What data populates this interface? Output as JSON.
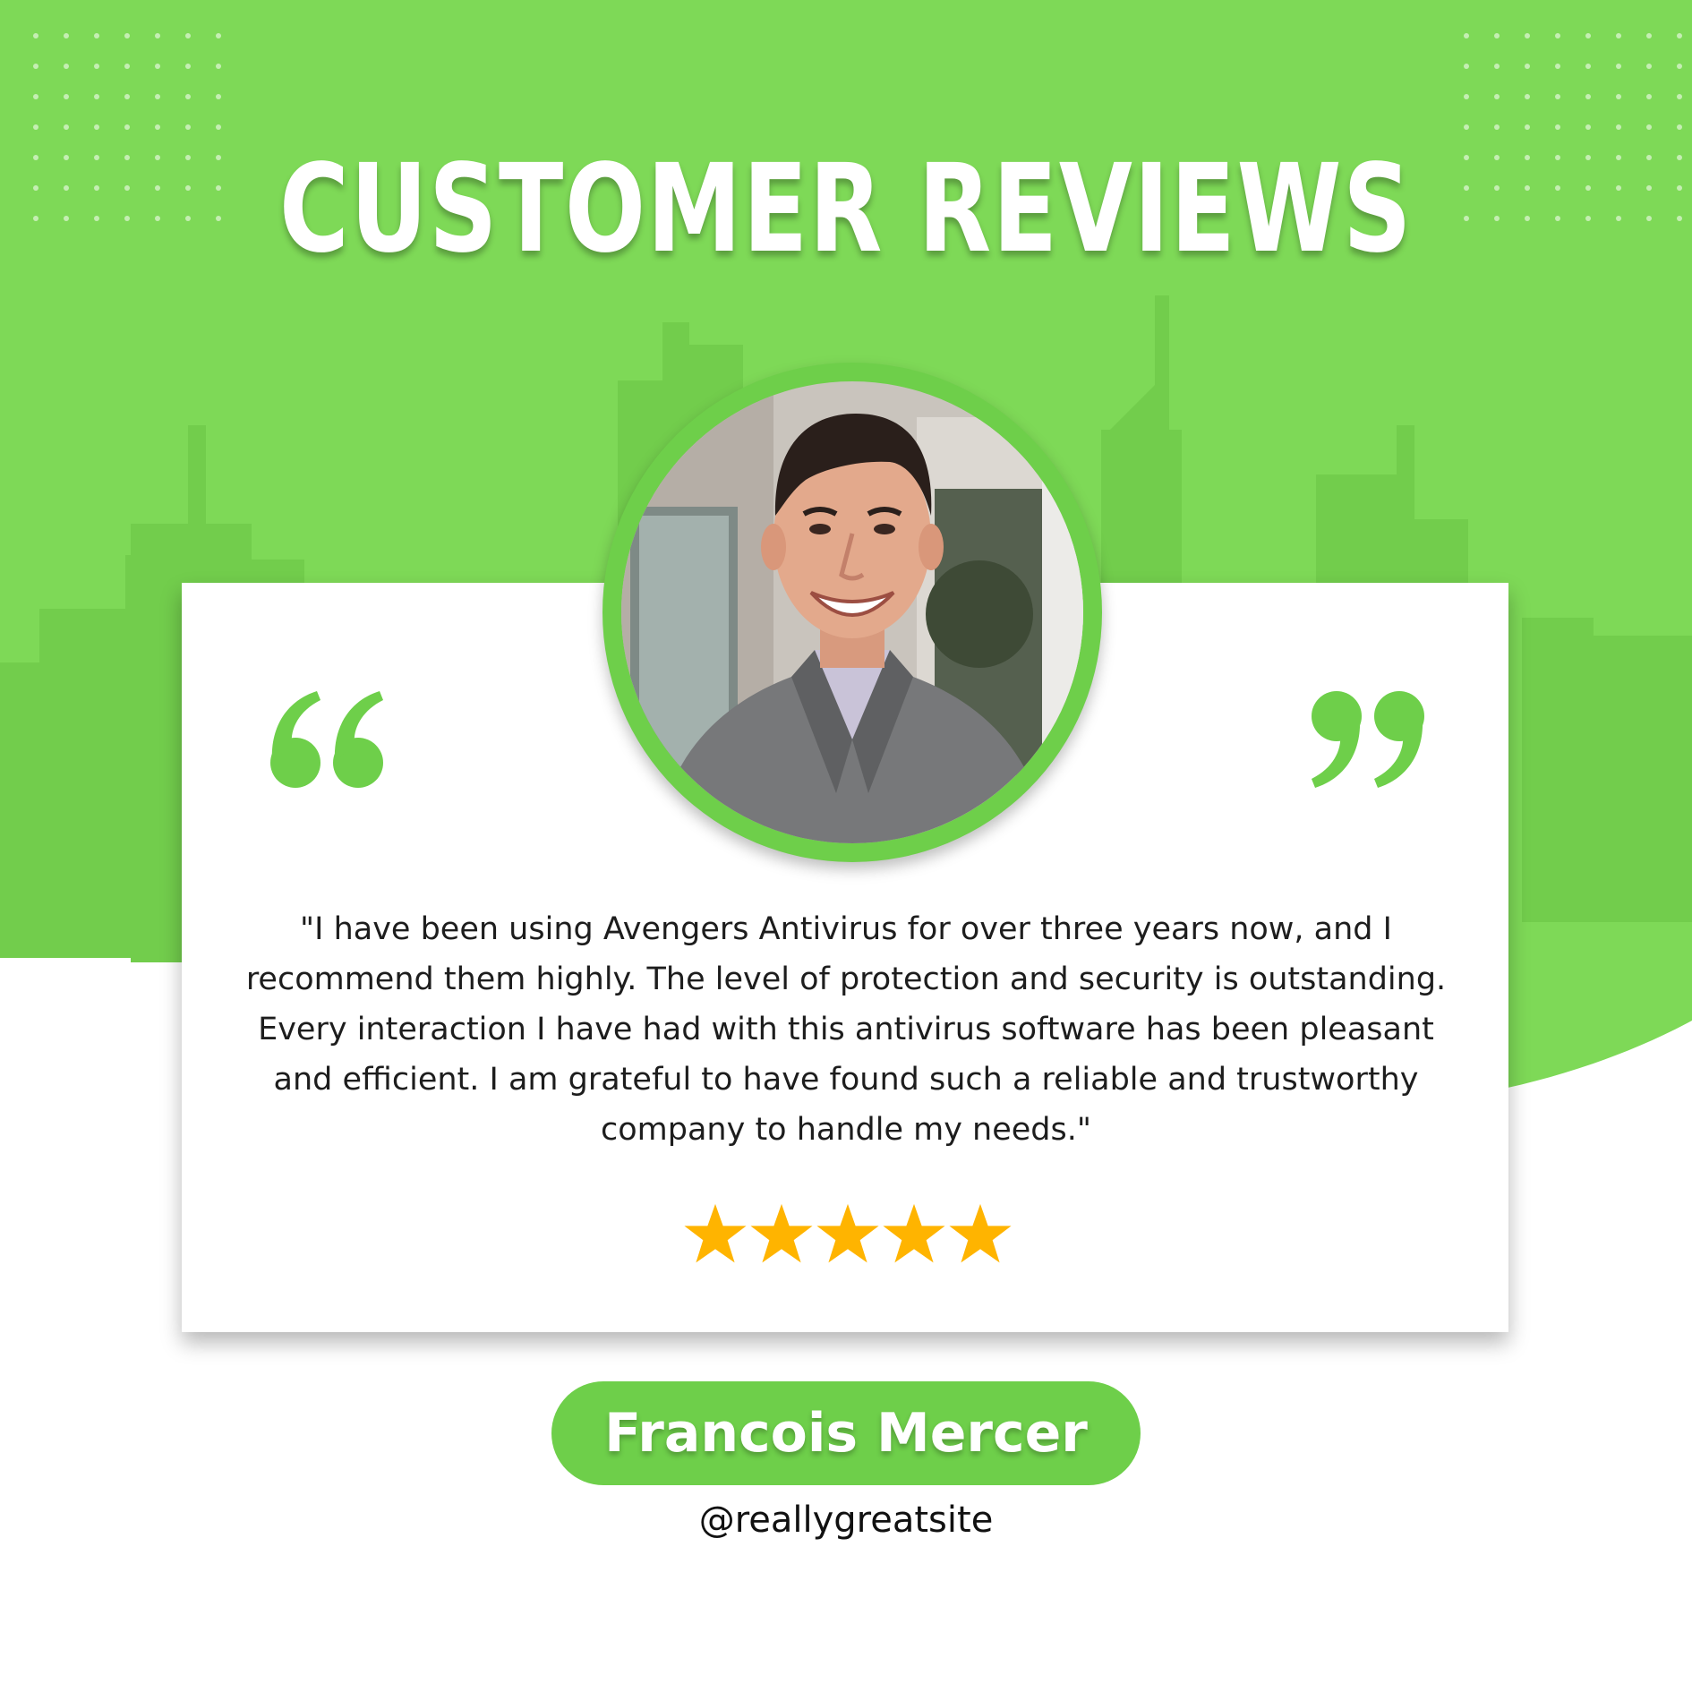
{
  "header": {
    "title": "CUSTOMER REVIEWS"
  },
  "review": {
    "text": "\"I have been using Avengers Antivirus for over three years now, and I recommend them highly. The level of protection and security is outstanding. Every interaction I have had with this antivirus software has been pleasant and efficient. I am grateful to have found such a reliable and trustworthy company to handle my needs.\"",
    "rating_stars": 5,
    "rating_max": 5,
    "quote_open_icon": "quote-open-icon",
    "quote_close_icon": "quote-close-icon",
    "avatar_icon": "person-portrait"
  },
  "reviewer": {
    "name": "Francois Mercer",
    "handle": "@reallygreatsite"
  },
  "colors": {
    "brand_green": "#6ecf4a",
    "background_green": "#7ed957",
    "star": "#ffb400",
    "text": "#1d1d1d",
    "white": "#ffffff"
  }
}
